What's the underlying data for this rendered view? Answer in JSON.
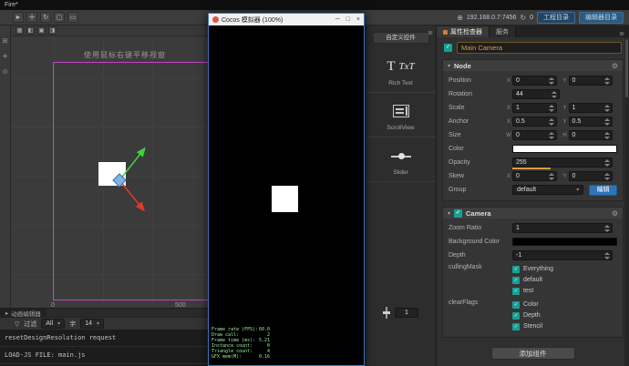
{
  "titlebar": {
    "title": "Fire*"
  },
  "toolbar": {
    "ip": "192.168.0.7:7456",
    "connection_count": "0",
    "project_dir_button": "工程目录",
    "editor_dir_button": "编辑器目录"
  },
  "scene": {
    "hint": "使用鼠标右键平移视窗",
    "ruler_zero": "0",
    "ruler_500": "500"
  },
  "timeline": {
    "tab": "动画编辑器"
  },
  "console": {
    "filter_label": "过滤",
    "filter_value": "All",
    "font_label": "字",
    "font_value": "14",
    "line1": "resetDesignResolution request",
    "line2": "LOAD-JS FILE: main.js"
  },
  "gallery": {
    "tab": "自定义控件",
    "items": [
      {
        "icon_big": "T",
        "icon": "TxT",
        "label": "Rich Text"
      },
      {
        "label": "ScrollView"
      },
      {
        "label": "Slider"
      }
    ],
    "page_value": "1"
  },
  "simulator": {
    "title": "Cocos 模拟器 (100%)",
    "minimize": "─",
    "maximize": "□",
    "close": "×",
    "stats": [
      {
        "label": "Frame rate (FPS):",
        "value": "60.0"
      },
      {
        "label": "Draw call:",
        "value": "2"
      },
      {
        "label": "Frame time (ms):",
        "value": "5.21"
      },
      {
        "label": "Instance count:",
        "value": "0"
      },
      {
        "label": "Triangle count:",
        "value": "4"
      },
      {
        "label": "GFX mem(M):",
        "value": "0.16"
      }
    ]
  },
  "inspector": {
    "tab_properties": "属性检查器",
    "tab_services": "服务",
    "node_name": "Main Camera",
    "node": {
      "title": "Node",
      "position_label": "Position",
      "position_x_label": "X",
      "position_x": "0",
      "position_y_label": "Y",
      "position_y": "0",
      "rotation_label": "Rotation",
      "rotation": "44",
      "scale_label": "Scale",
      "scale_x_label": "X",
      "scale_x": "1",
      "scale_y_label": "Y",
      "scale_y": "1",
      "anchor_label": "Anchor",
      "anchor_x_label": "X",
      "anchor_x": "0.5",
      "anchor_y_label": "Y",
      "anchor_y": "0.5",
      "size_label": "Size",
      "size_w_label": "W",
      "size_w": "0",
      "size_h_label": "H",
      "size_h": "0",
      "color_label": "Color",
      "opacity_label": "Opacity",
      "opacity": "255",
      "skew_label": "Skew",
      "skew_x_label": "X",
      "skew_x": "0",
      "skew_y_label": "Y",
      "skew_y": "0",
      "group_label": "Group",
      "group_value": "default",
      "group_edit": "编辑"
    },
    "camera": {
      "title": "Camera",
      "zoom_label": "Zoom Ratio",
      "zoom": "1",
      "bg_label": "Background Color",
      "depth_label": "Depth",
      "depth": "-1",
      "culling_label": "cullingMask",
      "culling_options": [
        "Everything",
        "default",
        "test"
      ],
      "clear_label": "clearFlags",
      "clear_options": [
        "Color",
        "Depth",
        "Stencil"
      ]
    },
    "add_component": "添加组件"
  },
  "colors": {
    "accent_orange": "#de9c3b",
    "accent_teal": "#14a296",
    "accent_blue": "#2f74b8",
    "gizmo_green": "#3fd13f",
    "gizmo_red": "#e03a2a",
    "design_border": "#c243c2",
    "node_color_value": "#ffffff",
    "camera_background_value": "#000000"
  },
  "icons": {
    "select_tool": "►",
    "move_tool": "✛",
    "rotate_tool": "↻",
    "scale_tool": "▢",
    "rect_tool": "▭",
    "network": "⊕",
    "refresh": "↻",
    "grid": "▦",
    "snap": "◧",
    "camera_view": "▣",
    "view_settings": "◨",
    "layout": "⊞",
    "pan": "✛",
    "zoom": "⊙",
    "timeline": "▸",
    "filter": "▽",
    "menu": "≣",
    "gear": "⚙",
    "check": "✓",
    "dropdown": "▾",
    "section_arrow": "▾"
  }
}
